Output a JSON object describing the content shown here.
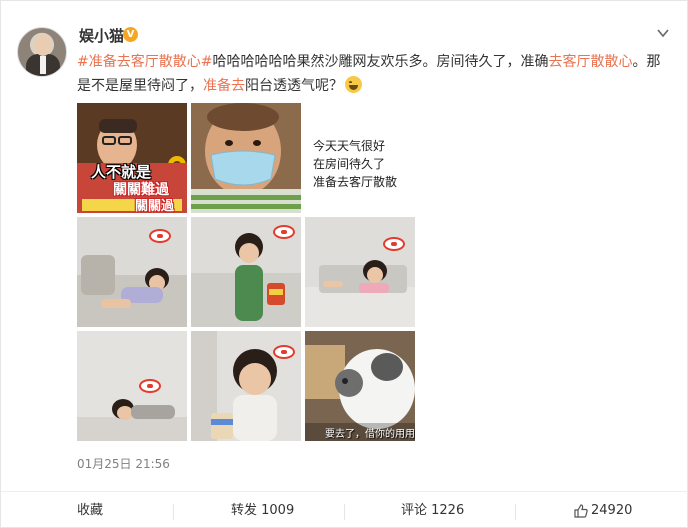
{
  "post": {
    "username": "娱小猫",
    "verified_mark": "V",
    "text_parts": [
      {
        "text": "#准备去客厅散散心#",
        "tag": true
      },
      {
        "text": "哈哈哈哈哈哈果然沙雕网友欢乐多。房间待久了，准确",
        "tag": false
      },
      {
        "text": "去客厅散散心",
        "tag": true
      },
      {
        "text": "。那是不是屋里待闷了，",
        "tag": false
      },
      {
        "text": "准备去",
        "tag": true
      },
      {
        "text": "阳台透透气呢？",
        "tag": false
      }
    ],
    "emoji": "laughing-emoji",
    "timestamp": "01月25日 21:56"
  },
  "images": {
    "img1_caption_1": "人不就是",
    "img1_caption_2": "關關難過",
    "img1_caption_3": "關關過",
    "img3_line_1": "今天天气很好",
    "img3_line_2": "在房间待久了",
    "img3_line_3": "准备去客厅散散",
    "img9_caption": "要去了，借你的用用"
  },
  "footer": {
    "favorite_label": "收藏",
    "repost_label": "转发 1009",
    "comment_label": "评论 1226",
    "like_count": "24920"
  },
  "colors": {
    "tag": "#eb7350",
    "verified": "#f5a623",
    "text": "#333333",
    "muted": "#808080"
  }
}
